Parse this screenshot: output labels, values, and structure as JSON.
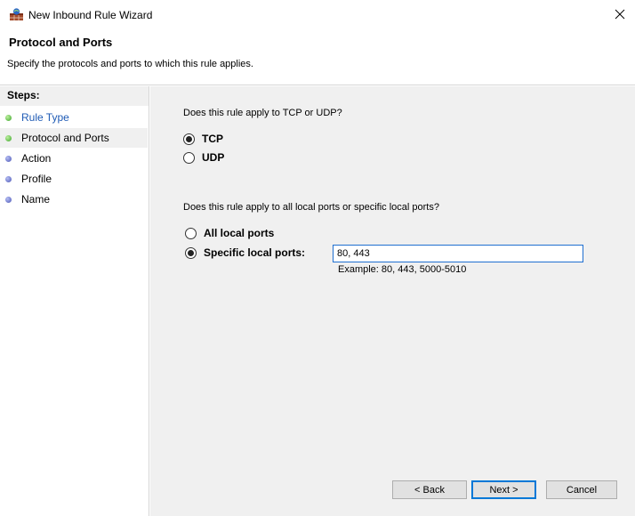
{
  "window": {
    "title": "New Inbound Rule Wizard"
  },
  "header": {
    "title": "Protocol and Ports",
    "subtitle": "Specify the protocols and ports to which this rule applies."
  },
  "steps": {
    "heading": "Steps:",
    "items": [
      {
        "label": "Rule Type",
        "state": "completed-link",
        "dot_color": "#3aa52a"
      },
      {
        "label": "Protocol and Ports",
        "state": "current",
        "dot_color": "#3aa52a"
      },
      {
        "label": "Action",
        "state": "pending",
        "dot_color": "#4a55b5"
      },
      {
        "label": "Profile",
        "state": "pending",
        "dot_color": "#4a55b5"
      },
      {
        "label": "Name",
        "state": "pending",
        "dot_color": "#4a55b5"
      }
    ]
  },
  "protocol": {
    "question": "Does this rule apply to TCP or UDP?",
    "options": [
      {
        "label": "TCP",
        "checked": true
      },
      {
        "label": "UDP",
        "checked": false
      }
    ]
  },
  "ports": {
    "question": "Does this rule apply to all local ports or specific local ports?",
    "options": [
      {
        "label": "All local ports",
        "checked": false
      },
      {
        "label": "Specific local ports:",
        "checked": true
      }
    ],
    "value": "80, 443",
    "example": "Example: 80, 443, 5000-5010"
  },
  "buttons": {
    "back": "< Back",
    "next": "Next >",
    "cancel": "Cancel"
  },
  "icons": {
    "app": "firewall-icon",
    "close": "close-icon"
  }
}
